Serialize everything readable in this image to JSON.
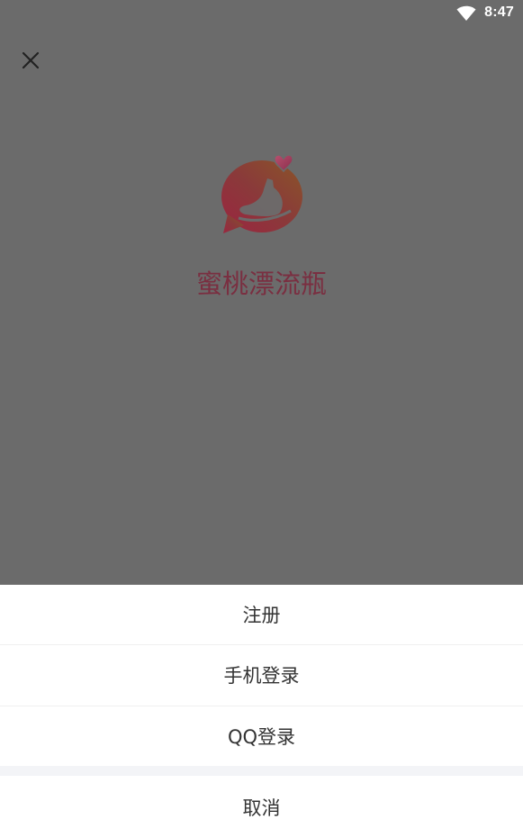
{
  "status_bar": {
    "time": "8:47",
    "wifi_icon": "wifi-icon"
  },
  "header": {
    "close_icon": "close-icon"
  },
  "brand": {
    "app_name": "蜜桃漂流瓶",
    "logo_icon": "bottle-chat-logo",
    "accent": "#7a2f41"
  },
  "overlay": {
    "color": "#6b6b6b"
  },
  "action_sheet": {
    "options": [
      {
        "label": "注册"
      },
      {
        "label": "手机登录"
      },
      {
        "label": "QQ登录"
      }
    ],
    "cancel_label": "取消"
  }
}
